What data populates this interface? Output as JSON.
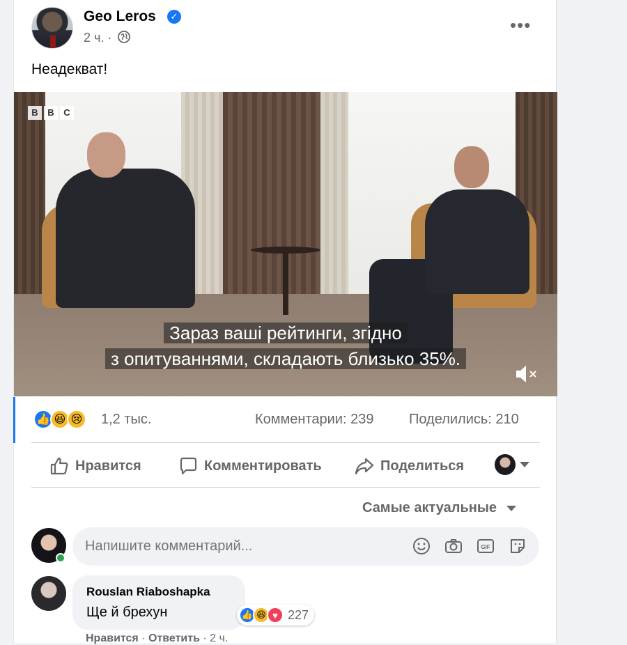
{
  "post": {
    "author": "Geo Leros",
    "time": "2 ч.",
    "separator": "·",
    "text": "Неадекват!"
  },
  "video": {
    "channel_logo": [
      "B",
      "B",
      "C"
    ],
    "subtitle_line1": "Зараз ваші рейтинги, згідно",
    "subtitle_line2": "з опитуваннями, складають близько 35%."
  },
  "stats": {
    "reactions_count": "1,2 тыс.",
    "comments": "Комментарии: 239",
    "shares": "Поделились: 210",
    "reaction_icons": [
      "like",
      "haha",
      "sad"
    ]
  },
  "actions": {
    "like": "Нравится",
    "comment": "Комментировать",
    "share": "Поделиться"
  },
  "sort_label": "Самые актуальные",
  "comment_input": {
    "placeholder": "Напишите комментарий..."
  },
  "comments": [
    {
      "author": "Rouslan Riaboshapka",
      "text": "Ще й брехун",
      "reactions_count": "227",
      "reaction_icons": [
        "like",
        "haha",
        "love"
      ],
      "like_label": "Нравится",
      "reply_label": "Ответить",
      "time": "2 ч."
    }
  ],
  "colors": {
    "accent": "#1877f2",
    "secondary_text": "#65676b",
    "online": "#31a24c"
  }
}
